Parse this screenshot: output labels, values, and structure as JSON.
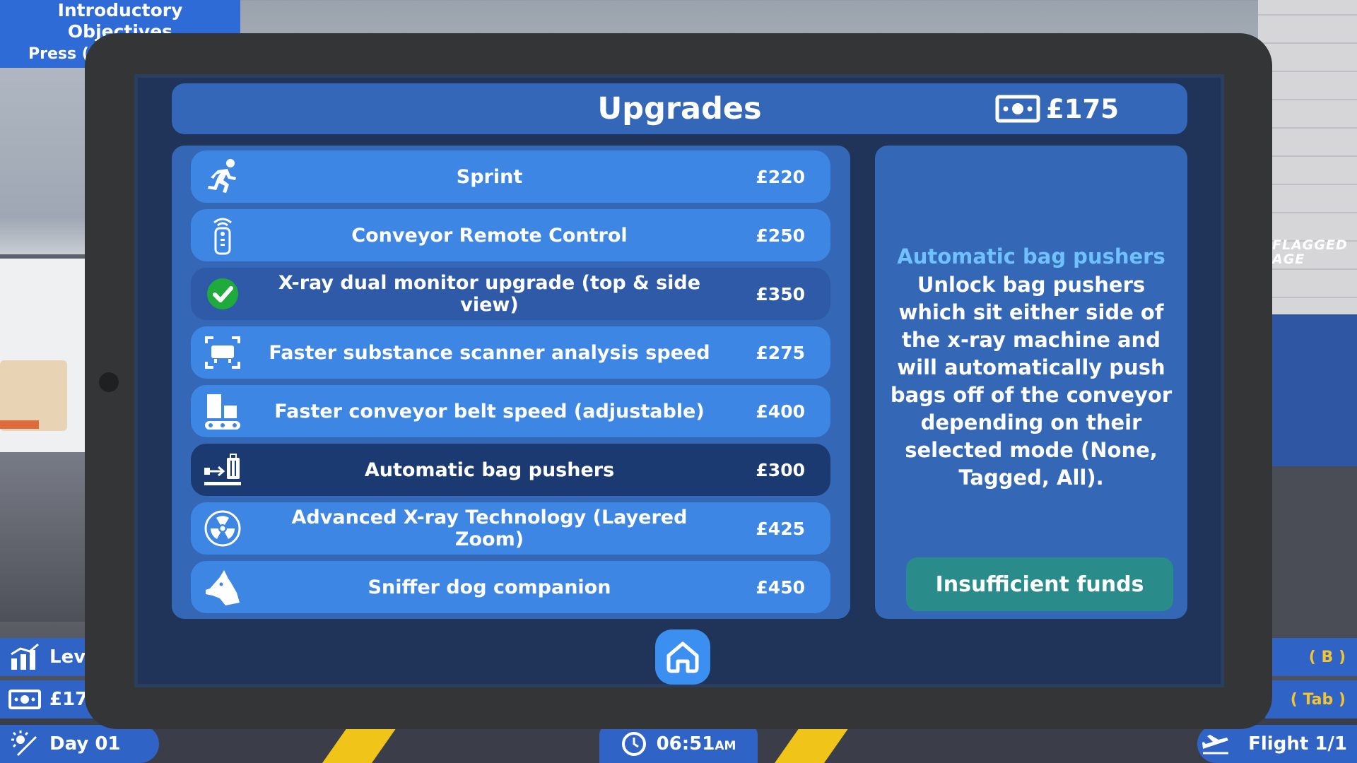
{
  "hud": {
    "objectives_title": "Introductory Objectives",
    "objectives_press": "Press (",
    "level_label": "Lev",
    "money_short": "£17",
    "day": "Day 01",
    "time": "06:51",
    "time_suffix": "AM",
    "flight": "Flight 1/1",
    "key_b": "( B )",
    "key_tab": "( Tab )"
  },
  "world": {
    "sign_line1": "FLAGGED",
    "sign_line2": "AGE"
  },
  "tablet": {
    "title": "Upgrades",
    "balance": "£175",
    "upgrades": [
      {
        "name": "Sprint",
        "price": "£220",
        "icon": "running-person-icon"
      },
      {
        "name": "Conveyor Remote Control",
        "price": "£250",
        "icon": "remote-control-icon"
      },
      {
        "name": "X-ray dual monitor upgrade (top & side view)",
        "price": "£350",
        "icon": "check-circle-icon"
      },
      {
        "name": "Faster substance scanner analysis speed",
        "price": "£275",
        "icon": "scanner-icon"
      },
      {
        "name": "Faster conveyor belt speed (adjustable)",
        "price": "£400",
        "icon": "conveyor-belt-icon"
      },
      {
        "name": "Automatic bag pushers",
        "price": "£300",
        "icon": "bag-pusher-icon"
      },
      {
        "name": "Advanced X-ray Technology (Layered Zoom)",
        "price": "£425",
        "icon": "radiation-icon"
      },
      {
        "name": "Sniffer dog companion",
        "price": "£450",
        "icon": "dog-head-icon"
      }
    ],
    "detail": {
      "title": "Automatic bag pushers",
      "description": "Unlock bag pushers which sit either side of the x-ray machine and will automatically push bags off of the conveyor depending on their selected mode (None, Tagged, All).",
      "button": "Insufficient funds"
    }
  },
  "colors": {
    "accent": "#3d86e3",
    "panel": "#3567b7",
    "selected": "#1c3a72",
    "detail_title": "#6fc1ff",
    "button": "#2a8c8a",
    "owned_check": "#1faa3c"
  }
}
